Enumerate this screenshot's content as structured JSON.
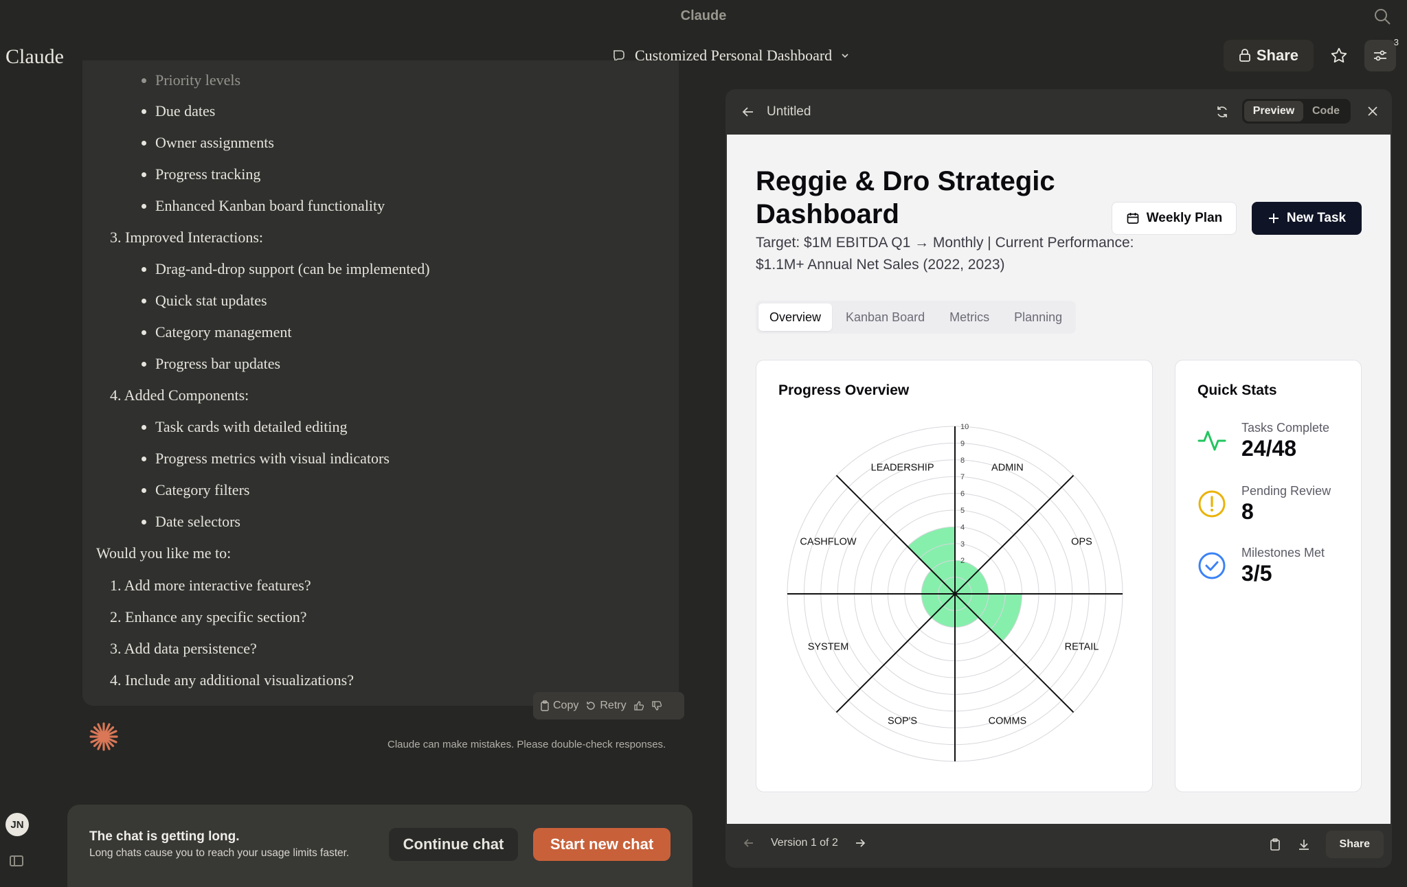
{
  "window": {
    "title": "Claude"
  },
  "topbar": {
    "logo": "Claude",
    "chat_title": "Customized Personal Dashboard",
    "share_label": "Share",
    "settings_badge": "3"
  },
  "chat": {
    "items": [
      {
        "kind": "bullet",
        "text": "Priority levels"
      },
      {
        "kind": "bullet",
        "text": "Due dates"
      },
      {
        "kind": "bullet",
        "text": "Owner assignments"
      },
      {
        "kind": "bullet",
        "text": "Progress tracking"
      },
      {
        "kind": "bullet",
        "text": "Enhanced Kanban board functionality"
      },
      {
        "kind": "num",
        "text": "3. Improved Interactions:"
      },
      {
        "kind": "bullet",
        "text": "Drag-and-drop support (can be implemented)"
      },
      {
        "kind": "bullet",
        "text": "Quick stat updates"
      },
      {
        "kind": "bullet",
        "text": "Category management"
      },
      {
        "kind": "bullet",
        "text": "Progress bar updates"
      },
      {
        "kind": "num",
        "text": "4. Added Components:"
      },
      {
        "kind": "bullet",
        "text": "Task cards with detailed editing"
      },
      {
        "kind": "bullet",
        "text": "Progress metrics with visual indicators"
      },
      {
        "kind": "bullet",
        "text": "Category filters"
      },
      {
        "kind": "bullet",
        "text": "Date selectors"
      },
      {
        "kind": "para",
        "text": "Would you like me to:"
      },
      {
        "kind": "num",
        "text": "1. Add more interactive features?"
      },
      {
        "kind": "num",
        "text": "2. Enhance any specific section?"
      },
      {
        "kind": "num",
        "text": "3. Add data persistence?"
      },
      {
        "kind": "num",
        "text": "4. Include any additional visualizations?"
      }
    ],
    "actions": {
      "copy": "Copy",
      "retry": "Retry"
    },
    "disclaimer": "Claude can make mistakes. Please double-check responses."
  },
  "long_chat": {
    "heading": "The chat is getting long.",
    "subtext": "Long chats cause you to reach your usage limits faster.",
    "continue_label": "Continue chat",
    "new_label": "Start new chat"
  },
  "user": {
    "initials": "JN"
  },
  "artifact": {
    "title": "Untitled",
    "preview_label": "Preview",
    "code_label": "Code",
    "version": "Version 1 of 2",
    "share_label": "Share",
    "dashboard": {
      "title": "Reggie & Dro Strategic Dashboard",
      "subtitle": "Target: $1M EBITDA Q1 → Monthly | Current Performance: $1.1M+ Annual Net Sales (2022, 2023)",
      "weekly_plan": "Weekly Plan",
      "new_task": "New Task",
      "tabs": [
        "Overview",
        "Kanban Board",
        "Metrics",
        "Planning"
      ],
      "progress_title": "Progress Overview",
      "quick_stats_title": "Quick Stats",
      "stats": [
        {
          "label": "Tasks Complete",
          "value": "24/48",
          "icon": "activity-icon",
          "color": "#22c55e"
        },
        {
          "label": "Pending Review",
          "value": "8",
          "icon": "alert-circle-icon",
          "color": "#eab308"
        },
        {
          "label": "Milestones Met",
          "value": "3/5",
          "icon": "check-circle-icon",
          "color": "#3b82f6"
        }
      ]
    }
  },
  "chart_data": {
    "type": "radar",
    "categories": [
      "ADMIN",
      "OPS",
      "RETAIL",
      "COMMS",
      "SOP'S",
      "SYSTEM",
      "CASHFLOW",
      "LEADERSHIP"
    ],
    "values": [
      2,
      2,
      4,
      2,
      2,
      2,
      2,
      4
    ],
    "rlim": [
      0,
      10
    ],
    "ticks": [
      "2",
      "3",
      "4",
      "5",
      "6",
      "7",
      "8",
      "9",
      "10"
    ],
    "fill_color": "#86efac"
  }
}
